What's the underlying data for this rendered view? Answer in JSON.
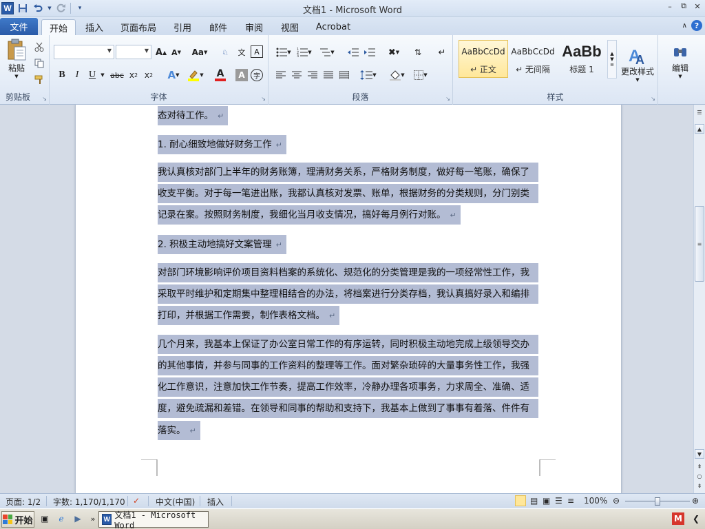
{
  "window": {
    "title": "文档1  -  Microsoft Word"
  },
  "file_tab": "文件",
  "tabs": [
    {
      "label": "开始",
      "active": true
    },
    {
      "label": "插入"
    },
    {
      "label": "页面布局"
    },
    {
      "label": "引用"
    },
    {
      "label": "邮件"
    },
    {
      "label": "审阅"
    },
    {
      "label": "视图"
    },
    {
      "label": "Acrobat"
    }
  ],
  "ribbon": {
    "clipboard": {
      "label": "剪贴板",
      "paste": "粘贴"
    },
    "font": {
      "label": "字体",
      "font_name": "",
      "font_size": ""
    },
    "paragraph": {
      "label": "段落"
    },
    "styles": {
      "label": "样式",
      "items": [
        {
          "sample": "AaBbCcDd",
          "name": "↵ 正文",
          "selected": true
        },
        {
          "sample": "AaBbCcDd",
          "name": "↵ 无间隔"
        },
        {
          "sample": "AaBb",
          "name": "标题 1"
        }
      ],
      "change_styles": "更改样式"
    },
    "editing": {
      "label": "编辑"
    }
  },
  "document": {
    "lines": [
      {
        "text": "态对待工作。",
        "pm": "↵"
      },
      {
        "text": "1. 耐心细致地做好财务工作",
        "pm": "↵"
      },
      {
        "text": "我认真核对部门上半年的财务账簿，理清财务关系，严格财务制度，做好每一笔账，确保了"
      },
      {
        "text": "收支平衡。对于每一笔进出账，我都认真核对发票、账单，根据财务的分类规则，分门别类"
      },
      {
        "text": "记录在案。按照财务制度，我细化当月收支情况，搞好每月例行对账。",
        "pm": "↵"
      },
      {
        "text": "2. 积极主动地搞好文案管理",
        "pm": "↵"
      },
      {
        "text": "对部门环境影响评价项目资料档案的系统化、规范化的分类管理是我的一项经常性工作，我"
      },
      {
        "text": "采取平时维护和定期集中整理相结合的办法，将档案进行分类存档，我认真搞好录入和编排"
      },
      {
        "text": "打印，并根据工作需要，制作表格文档。",
        "pm": "↵"
      },
      {
        "text": "几个月来，我基本上保证了办公室日常工作的有序运转，同时积极主动地完成上级领导交办"
      },
      {
        "text": "的其他事情，并参与同事的工作资料的整理等工作。面对繁杂琐碎的大量事务性工作，我强"
      },
      {
        "text": "化工作意识，注意加快工作节奏，提高工作效率，冷静办理各项事务，力求周全、准确、适"
      },
      {
        "text": "度，避免疏漏和差错。在领导和同事的帮助和支持下，我基本上做到了事事有着落、件件有"
      },
      {
        "text": "落实。",
        "pm": "↵"
      }
    ]
  },
  "statusbar": {
    "page": "页面: 1/2",
    "words": "字数: 1,170/1,170",
    "language": "中文(中国)",
    "mode": "插入",
    "zoom": "100%"
  },
  "taskbar": {
    "start": "开始",
    "word_task": "文档1 - Microsoft Word"
  },
  "colors": {
    "accent": "#2a5aa8",
    "highlight": "#b3bcd4"
  }
}
